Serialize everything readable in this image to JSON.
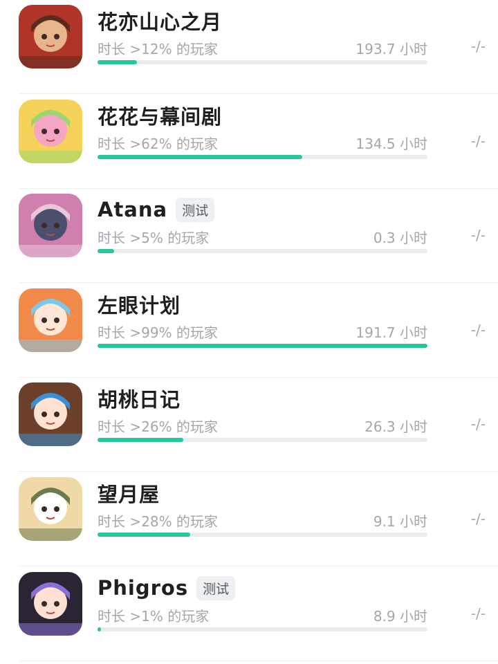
{
  "games": [
    {
      "name": "花亦山心之月",
      "badge": "",
      "share_text": "时长 >12% 的玩家",
      "share_fraction": 0.12,
      "hours": "193.7 小时",
      "rank": "-/-",
      "icon": "anime-girl-flowers-icon",
      "icon_colors": [
        "#b03428",
        "#e8b48a",
        "#5b2a1f"
      ]
    },
    {
      "name": "花花与幕间剧",
      "badge": "",
      "share_text": "时长 >62% 的玩家",
      "share_fraction": 0.62,
      "hours": "134.5 小时",
      "rank": "-/-",
      "icon": "blonde-girl-cat-icon",
      "icon_colors": [
        "#f6d25a",
        "#f4a6c4",
        "#9bd76e"
      ]
    },
    {
      "name": "Atana",
      "badge": "测试",
      "share_text": "时长 >5% 的玩家",
      "share_fraction": 0.05,
      "hours": "0.3 小时",
      "rank": "-/-",
      "icon": "pink-hair-character-icon",
      "icon_colors": [
        "#d17fae",
        "#4a4f6e",
        "#e9c6d8"
      ]
    },
    {
      "name": "左眼计划",
      "badge": "",
      "share_text": "时长 >99% 的玩家",
      "share_fraction": 1.0,
      "hours": "191.7 小时",
      "rank": "-/-",
      "icon": "orange-hair-wink-icon",
      "icon_colors": [
        "#f28a4a",
        "#ffe7d6",
        "#7fc7e8"
      ]
    },
    {
      "name": "胡桃日记",
      "badge": "",
      "share_text": "时长 >26% 的玩家",
      "share_fraction": 0.26,
      "hours": "26.3 小时",
      "rank": "-/-",
      "icon": "brown-hair-girl-icon",
      "icon_colors": [
        "#6b3f2a",
        "#ffe2d0",
        "#3a8fd6"
      ]
    },
    {
      "name": "望月屋",
      "badge": "",
      "share_text": "时长 >28% 的玩家",
      "share_fraction": 0.28,
      "hours": "9.1 小时",
      "rank": "-/-",
      "icon": "white-rabbit-icon",
      "icon_colors": [
        "#efd9a6",
        "#ffffff",
        "#6c7a4e"
      ]
    },
    {
      "name": "Phigros",
      "badge": "测试",
      "share_text": "时长 >1% 的玩家",
      "share_fraction": 0.01,
      "hours": "8.9 小时",
      "rank": "-/-",
      "icon": "dark-hair-girl-icon",
      "icon_colors": [
        "#2a2433",
        "#ffe0d2",
        "#8c6fd6"
      ]
    }
  ],
  "colors": {
    "progress_fill": "#22c99b",
    "progress_track": "#e9ecee",
    "text_muted": "#a3a7ab",
    "badge_bg": "#eef0f2"
  }
}
